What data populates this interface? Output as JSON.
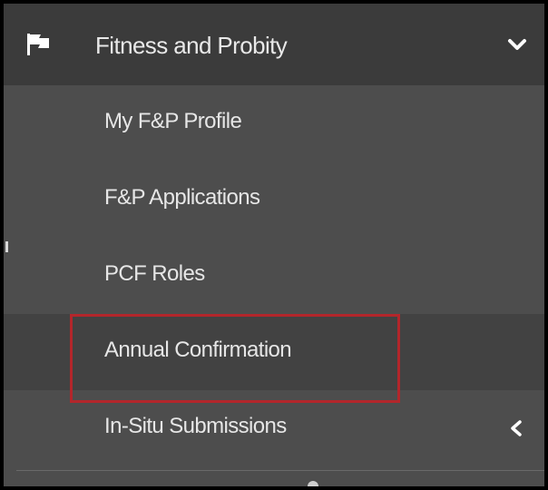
{
  "menu": {
    "section": {
      "title": "Fitness and Probity",
      "icon": "flag-icon",
      "toggle_icon": "chevron-down-icon"
    },
    "items": [
      {
        "label": "My F&P Profile"
      },
      {
        "label": "F&P Applications"
      },
      {
        "label": "PCF Roles"
      },
      {
        "label": "Annual Confirmation",
        "active": true,
        "highlighted": true
      },
      {
        "label": "In-Situ Submissions",
        "icon": "chevron-left-icon"
      }
    ]
  },
  "colors": {
    "header_bg": "#3b3b3b",
    "menu_bg": "#4d4d4d",
    "active_bg": "#424242",
    "text": "#e6e6e6",
    "highlight_border": "#b3262b"
  }
}
